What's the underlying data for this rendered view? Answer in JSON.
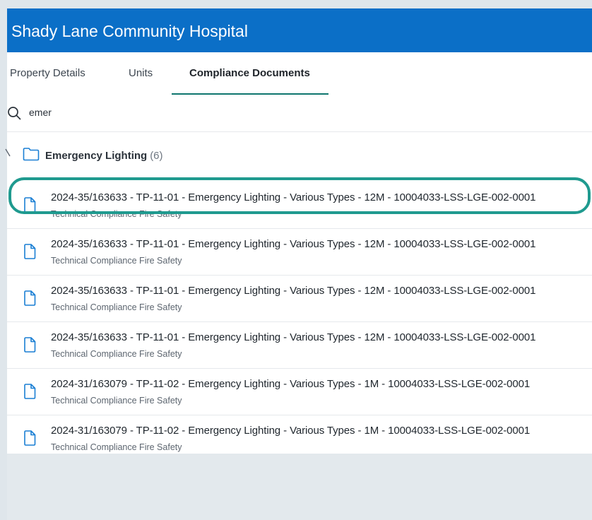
{
  "app": {
    "title": "Shady Lane Community Hospital"
  },
  "tabs": [
    {
      "label": "Property Details",
      "active": false
    },
    {
      "label": "Units",
      "active": false
    },
    {
      "label": "Compliance Documents",
      "active": true
    }
  ],
  "search": {
    "value": "emer",
    "icon": "search-icon"
  },
  "group": {
    "name": "Emergency Lighting",
    "count": "(6)",
    "icon": "folder-icon",
    "expanded": true
  },
  "documents": [
    {
      "name": "2024-35/163633 - TP-11-01 - Emergency Lighting - Various Types - 12M - 10004033-LSS-LGE-002-0001",
      "category": "Technical Compliance Fire Safety",
      "highlighted": true
    },
    {
      "name": "2024-35/163633 - TP-11-01 - Emergency Lighting - Various Types - 12M - 10004033-LSS-LGE-002-0001",
      "category": "Technical Compliance Fire Safety",
      "highlighted": false
    },
    {
      "name": "2024-35/163633 - TP-11-01 - Emergency Lighting - Various Types - 12M - 10004033-LSS-LGE-002-0001",
      "category": "Technical Compliance Fire Safety",
      "highlighted": false
    },
    {
      "name": "2024-35/163633 - TP-11-01 - Emergency Lighting - Various Types - 12M - 10004033-LSS-LGE-002-0001",
      "category": "Technical Compliance Fire Safety",
      "highlighted": false
    },
    {
      "name": "2024-31/163079 - TP-11-02 - Emergency Lighting - Various Types - 1M - 10004033-LSS-LGE-002-0001",
      "category": "Technical Compliance Fire Safety",
      "highlighted": false
    },
    {
      "name": "2024-31/163079 - TP-11-02 - Emergency Lighting - Various Types - 1M - 10004033-LSS-LGE-002-0001",
      "category": "Technical Compliance Fire Safety",
      "highlighted": false
    }
  ],
  "colors": {
    "header": "#0b6fc7",
    "active_tab_underline": "#0f766e",
    "highlight_ring": "#1f9a8f",
    "icon_blue": "#1a7fd4"
  }
}
